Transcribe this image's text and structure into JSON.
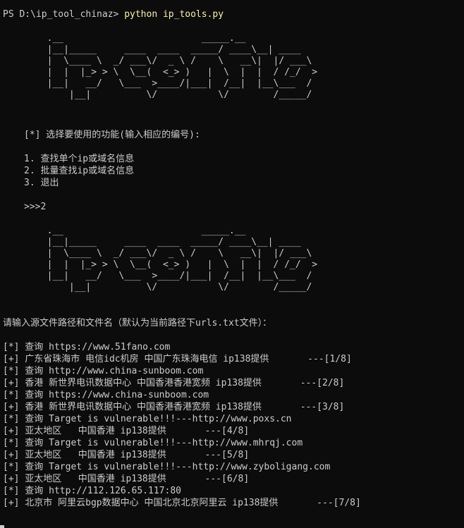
{
  "prompt": {
    "path": "PS D:\\ip_tool_chinaz> ",
    "command": "python ip_tools.py"
  },
  "banner": [
    "        .__                         _____.__",
    "        |__|_____     ____  ____  _____/ ____\\__| ____",
    "        |  \\____ \\  _/ ___\\/  _ \\ /    \\   __\\|  |/ ___\\",
    "        |  |  |_> > \\  \\__(  <_> )   |  \\  |  |  / /_/  >",
    "        |__|   __/   \\___  >____/|___|  /__|  |__\\___  /",
    "            |__|          \\/           \\/        /_____/"
  ],
  "menu": {
    "title": "[*] 选择要使用的功能(输入相应的编号):",
    "options": [
      "1. 查找单个ip或域名信息",
      "2. 批量查找ip或域名信息",
      "3. 退出"
    ],
    "input": ">>>2"
  },
  "file_prompt": "请输入源文件路径和文件名（默认为当前路径下urls.txt文件）：",
  "results": [
    "[*] 查询 https://www.51fano.com",
    "[+] 广东省珠海市 电信idc机房 中国广东珠海电信 ip138提供       ---[1/8]",
    "[*] 查询 http://www.china-sunboom.com",
    "[+] 香港 新世界电讯数据中心 中国香港香港宽频 ip138提供       ---[2/8]",
    "[*] 查询 https://www.china-sunboom.com",
    "[+] 香港 新世界电讯数据中心 中国香港香港宽频 ip138提供       ---[3/8]",
    "[*] 查询 Target is vulnerable!!!---http://www.poxs.cn",
    "[+] 亚太地区   中国香港 ip138提供       ---[4/8]",
    "[*] 查询 Target is vulnerable!!!---http://www.mhrqj.com",
    "[+] 亚太地区   中国香港 ip138提供       ---[5/8]",
    "[*] 查询 Target is vulnerable!!!---http://www.zyboligang.com",
    "[+] 亚太地区   中国香港 ip138提供       ---[6/8]",
    "[*] 查询 http://112.126.65.117:80",
    "[+] 北京市 阿里云bgp数据中心 中国北京北京阿里云 ip138提供       ---[7/8]"
  ]
}
